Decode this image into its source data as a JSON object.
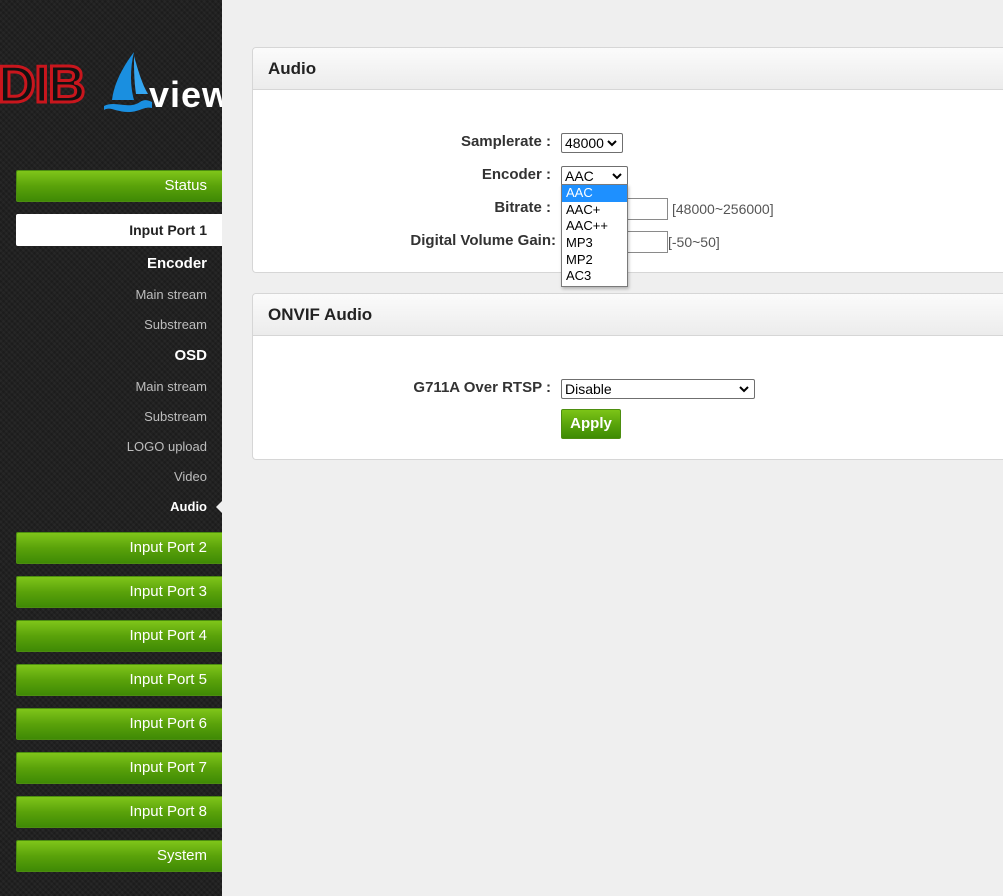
{
  "logo": {
    "brand_red": "DIB",
    "brand_white": "view"
  },
  "sidebar": {
    "status": "Status",
    "input_port_1": "Input Port 1",
    "encoder_head": "Encoder",
    "encoder_main": "Main stream",
    "encoder_sub": "Substream",
    "osd_head": "OSD",
    "osd_main": "Main stream",
    "osd_sub": "Substream",
    "logo_upload": "LOGO upload",
    "video": "Video",
    "audio": "Audio",
    "ports": [
      "Input Port 2",
      "Input Port 3",
      "Input Port 4",
      "Input Port 5",
      "Input Port 6",
      "Input Port 7",
      "Input Port 8"
    ],
    "system": "System"
  },
  "audio_panel": {
    "title": "Audio",
    "samplerate_label": "Samplerate :",
    "samplerate_value": "48000",
    "encoder_label": "Encoder :",
    "encoder_value": "AAC",
    "encoder_options": [
      "AAC",
      "AAC+",
      "AAC++",
      "MP3",
      "MP2",
      "AC3"
    ],
    "bitrate_label": "Bitrate :",
    "bitrate_value": "",
    "bitrate_range": "[48000~256000]",
    "gain_label": "Digital Volume Gain:",
    "gain_value": "",
    "gain_range": "[-50~50]"
  },
  "onvif_panel": {
    "title": "ONVIF Audio",
    "g711_label": "G711A Over RTSP :",
    "g711_value": "Disable",
    "apply_label": "Apply"
  },
  "colors": {
    "accent_green": "#5aa20a",
    "brand_red": "#c8161d",
    "selection_blue": "#1e90ff"
  }
}
